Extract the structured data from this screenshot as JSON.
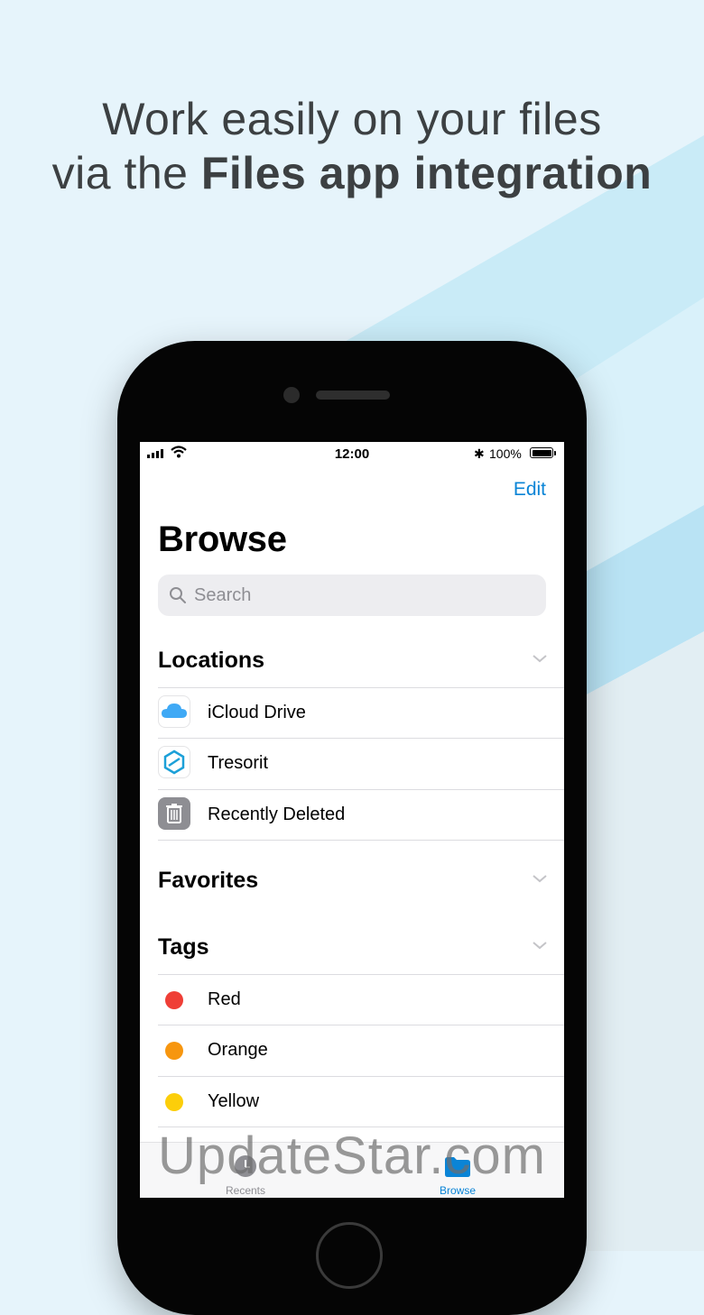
{
  "headline": {
    "line1": "Work easily on your files",
    "line2_regular": "via the ",
    "line2_bold": "Files app integration"
  },
  "status_bar": {
    "time": "12:00",
    "battery": "100%"
  },
  "header": {
    "edit_label": "Edit",
    "title": "Browse"
  },
  "search": {
    "placeholder": "Search"
  },
  "locations": {
    "heading": "Locations",
    "items": [
      {
        "label": "iCloud Drive",
        "icon": "cloud-icon"
      },
      {
        "label": "Tresorit",
        "icon": "tresorit-icon"
      },
      {
        "label": "Recently Deleted",
        "icon": "trash-icon"
      }
    ]
  },
  "favorites": {
    "heading": "Favorites"
  },
  "tags": {
    "heading": "Tags",
    "items": [
      {
        "label": "Red",
        "color": "#ef3e36"
      },
      {
        "label": "Orange",
        "color": "#f7960f"
      },
      {
        "label": "Yellow",
        "color": "#fcce0a"
      }
    ]
  },
  "tabbar": {
    "recents_label": "Recents",
    "browse_label": "Browse",
    "active_color": "#0a84d6"
  },
  "watermark": "UpdateStar.com",
  "colors": {
    "accent": "#0a84d6",
    "background": "#e6f4fb"
  }
}
